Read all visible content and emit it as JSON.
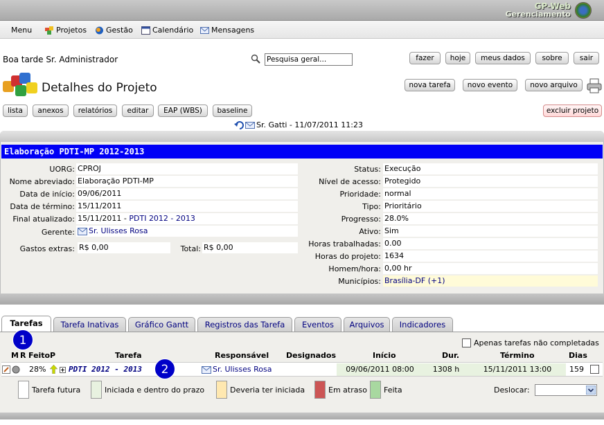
{
  "brand": {
    "line1": "GP-Web",
    "line2": "Gerenciamento"
  },
  "menu": {
    "main": "Menu",
    "items": [
      "Projetos",
      "Gestão",
      "Calendário",
      "Mensagens"
    ]
  },
  "greeting": "Boa tarde Sr. Administrador",
  "search": {
    "value": "Pesquisa geral..."
  },
  "topbuttons": [
    "fazer",
    "hoje",
    "meus dados",
    "sobre",
    "sair"
  ],
  "page_title": "Detalhes do Projeto",
  "actions": [
    "nova tarefa",
    "novo evento",
    "novo arquivo"
  ],
  "toolbar": [
    "lista",
    "anexos",
    "relatórios",
    "editar",
    "EAP (WBS)",
    "baseline"
  ],
  "delete_label": "excluir projeto",
  "history": "Sr. Gatti - 11/07/2011 11:23",
  "project": {
    "header": "Elaboração PDTI-MP 2012-2013",
    "left": [
      {
        "label": "UORG:",
        "value": "CPROJ"
      },
      {
        "label": "Nome abreviado:",
        "value": "Elaboração PDTI-MP"
      },
      {
        "label": "Data de início:",
        "value": "09/06/2011"
      },
      {
        "label": "Data de término:",
        "value": "15/11/2011"
      },
      {
        "label": "Final atualizado:",
        "value": "15/11/2011 - ",
        "link": "PDTI 2012 - 2013"
      },
      {
        "label": "Gerente:",
        "value": "Sr. Ulisses Rosa"
      }
    ],
    "extras_label": "Gastos extras:",
    "extras_value": "R$ 0,00",
    "total_label": "Total:",
    "total_value": "R$ 0,00",
    "right": [
      {
        "label": "Status:",
        "value": "Execução"
      },
      {
        "label": "Nível de acesso:",
        "value": "Protegido"
      },
      {
        "label": "Prioridade:",
        "value": "normal"
      },
      {
        "label": "Tipo:",
        "value": "Prioritário"
      },
      {
        "label": "Progresso:",
        "value": "28.0%"
      },
      {
        "label": "Ativo:",
        "value": "Sim"
      },
      {
        "label": "Horas trabalhadas:",
        "value": "0.00"
      },
      {
        "label": "Horas do projeto:",
        "value": "1634"
      },
      {
        "label": "Homem/hora:",
        "value": "0,00 hr"
      },
      {
        "label": "Municípios:",
        "value": "Brasília-DF (+1)"
      }
    ]
  },
  "tabs": [
    "Tarefas",
    "Tarefa Inativas",
    "Gráfico Gantt",
    "Registros das Tarefa",
    "Eventos",
    "Arquivos",
    "Indicadores"
  ],
  "markers": [
    "1",
    "2"
  ],
  "filter_label": "Apenas tarefas não completadas",
  "columns": [
    "M",
    "R",
    "Feito",
    "P",
    "Tarefa",
    "Responsável",
    "Designados",
    "Início",
    "Dur.",
    "Término",
    "Dias"
  ],
  "task": {
    "done": "28%",
    "name": "PDTI 2012 - 2013",
    "owner": "Sr. Ulisses Rosa",
    "start": "09/06/2011 08:00",
    "duration": "1308 h",
    "end": "15/11/2011 13:00",
    "days": "159"
  },
  "legend": [
    "Tarefa futura",
    "Iniciada e dentro do prazo",
    "Deveria ter iniciada",
    "Em atraso",
    "Feita"
  ],
  "legend_colors": [
    "#ffffff",
    "#e8f2e0",
    "#ffe8b0",
    "#cc5555",
    "#a8d8a0"
  ],
  "move_label": "Deslocar:"
}
